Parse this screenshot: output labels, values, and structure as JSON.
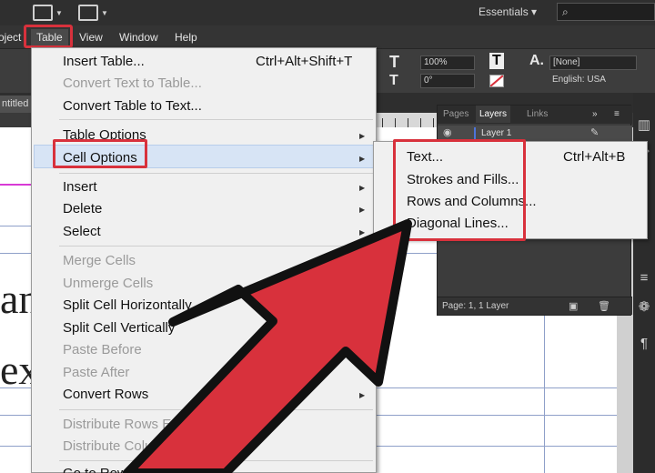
{
  "topbar": {
    "workspace_label": "Essentials",
    "workspace_arrow": "▾",
    "search_icon": "search-icon"
  },
  "menubar": {
    "items": [
      "oject",
      "Table",
      "View",
      "Window",
      "Help"
    ]
  },
  "controlbar": {
    "scale_value": "100%",
    "angle_value": "0°",
    "style_value": "[None]",
    "language_value": "English: USA"
  },
  "document": {
    "tab_title": "ntitled",
    "text_line1": "an",
    "text_line2": "ex"
  },
  "layers_panel": {
    "tabs": [
      "Pages",
      "Layers",
      "Links"
    ],
    "layer_name": "Layer 1",
    "status": "Page: 1, 1 Layer"
  },
  "table_menu": {
    "items": [
      {
        "label": "Insert Table...",
        "shortcut": "Ctrl+Alt+Shift+T",
        "enabled": true,
        "submenu": false
      },
      {
        "label": "Convert Text to Table...",
        "shortcut": "",
        "enabled": false,
        "submenu": false
      },
      {
        "label": "Convert Table to Text...",
        "shortcut": "",
        "enabled": true,
        "submenu": false
      },
      {
        "label": "Table Options",
        "shortcut": "",
        "enabled": true,
        "submenu": true
      },
      {
        "label": "Cell Options",
        "shortcut": "",
        "enabled": true,
        "submenu": true,
        "hovered": true
      },
      {
        "label": "Insert",
        "shortcut": "",
        "enabled": true,
        "submenu": true
      },
      {
        "label": "Delete",
        "shortcut": "",
        "enabled": true,
        "submenu": true
      },
      {
        "label": "Select",
        "shortcut": "",
        "enabled": true,
        "submenu": true
      },
      {
        "label": "Merge Cells",
        "shortcut": "",
        "enabled": false,
        "submenu": false
      },
      {
        "label": "Unmerge Cells",
        "shortcut": "",
        "enabled": false,
        "submenu": false
      },
      {
        "label": "Split Cell Horizontally",
        "shortcut": "",
        "enabled": true,
        "submenu": false
      },
      {
        "label": "Split Cell Vertically",
        "shortcut": "",
        "enabled": true,
        "submenu": false
      },
      {
        "label": "Paste Before",
        "shortcut": "",
        "enabled": false,
        "submenu": false
      },
      {
        "label": "Paste After",
        "shortcut": "",
        "enabled": false,
        "submenu": false
      },
      {
        "label": "Convert Rows",
        "shortcut": "",
        "enabled": true,
        "submenu": true
      },
      {
        "label": "Distribute Rows Ev",
        "shortcut": "",
        "enabled": false,
        "submenu": false
      },
      {
        "label": "Distribute Columns",
        "shortcut": "",
        "enabled": false,
        "submenu": false
      },
      {
        "label": "Go to Row...",
        "shortcut": "",
        "enabled": true,
        "submenu": false
      }
    ]
  },
  "cell_options_submenu": {
    "items": [
      {
        "label": "Text...",
        "shortcut": "Ctrl+Alt+B"
      },
      {
        "label": "Strokes and Fills...",
        "shortcut": ""
      },
      {
        "label": "Rows and Columns...",
        "shortcut": ""
      },
      {
        "label": "Diagonal Lines...",
        "shortcut": ""
      }
    ]
  },
  "colors": {
    "highlight_red": "#d8313c",
    "menu_bg": "#f0f0f0",
    "hover_blue": "#d7e4f5",
    "disabled_text": "#9a9a9a"
  }
}
